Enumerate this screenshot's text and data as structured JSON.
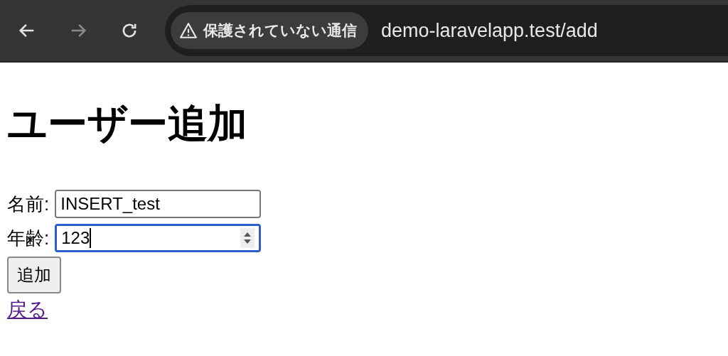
{
  "browser": {
    "nav": [
      {
        "kind": "back",
        "disabled": false
      },
      {
        "kind": "forward",
        "disabled": true
      },
      {
        "kind": "reload",
        "disabled": false
      }
    ],
    "security_chip": "保護されていない通信",
    "url": "demo-laravelapp.test/add"
  },
  "page": {
    "heading": "ユーザー追加",
    "fields": [
      {
        "label": "名前:",
        "value": "INSERT_test",
        "kind": "text",
        "focused": false
      },
      {
        "label": "年齢:",
        "value": "123",
        "kind": "number",
        "focused": true
      }
    ],
    "submit_button": "追加",
    "back_link": "戻る"
  }
}
